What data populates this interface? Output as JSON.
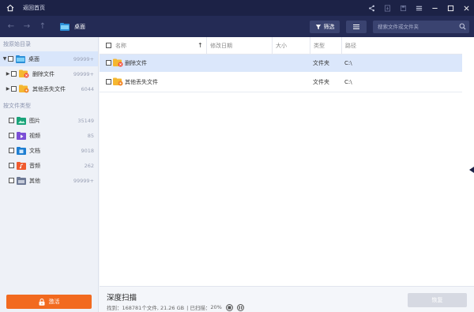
{
  "titlebar": {
    "title": "返回首页"
  },
  "toolbar": {
    "breadcrumb": "桌面",
    "filter_label": "筛选",
    "search_placeholder": "搜索文件或文件夹"
  },
  "sidebar": {
    "by_path_title": "按原始目录",
    "tree": [
      {
        "label": "桌面",
        "count": "99999+"
      },
      {
        "label": "删除文件",
        "count": "99999+"
      },
      {
        "label": "其他丢失文件",
        "count": "6044"
      }
    ],
    "by_type_title": "按文件类型",
    "categories": [
      {
        "label": "图片",
        "count": "35149"
      },
      {
        "label": "视频",
        "count": "85"
      },
      {
        "label": "文档",
        "count": "9018"
      },
      {
        "label": "音频",
        "count": "262"
      },
      {
        "label": "其他",
        "count": "99999+"
      }
    ],
    "activate_label": "激活"
  },
  "table": {
    "headers": {
      "name": "名称",
      "modified": "修改日期",
      "size": "大小",
      "type": "类型",
      "path": "路径"
    },
    "rows": [
      {
        "name": "删除文件",
        "modified": "",
        "size": "",
        "type": "文件夹",
        "path": "C:\\"
      },
      {
        "name": "其他丢失文件",
        "modified": "",
        "size": "",
        "type": "文件夹",
        "path": "C:\\"
      }
    ]
  },
  "status": {
    "title": "深度扫描",
    "found_label": "找到：",
    "found_value": "168781个文件, 21.26 GB",
    "scanned_label": "| 已扫描：",
    "scanned_value": "20%",
    "recover_label": "恢复"
  },
  "colors": {
    "titlebar_bg": "#1c2246",
    "toolbar_bg": "#242b55",
    "accent_orange": "#f26a1f",
    "selection": "#d9e6fb"
  }
}
